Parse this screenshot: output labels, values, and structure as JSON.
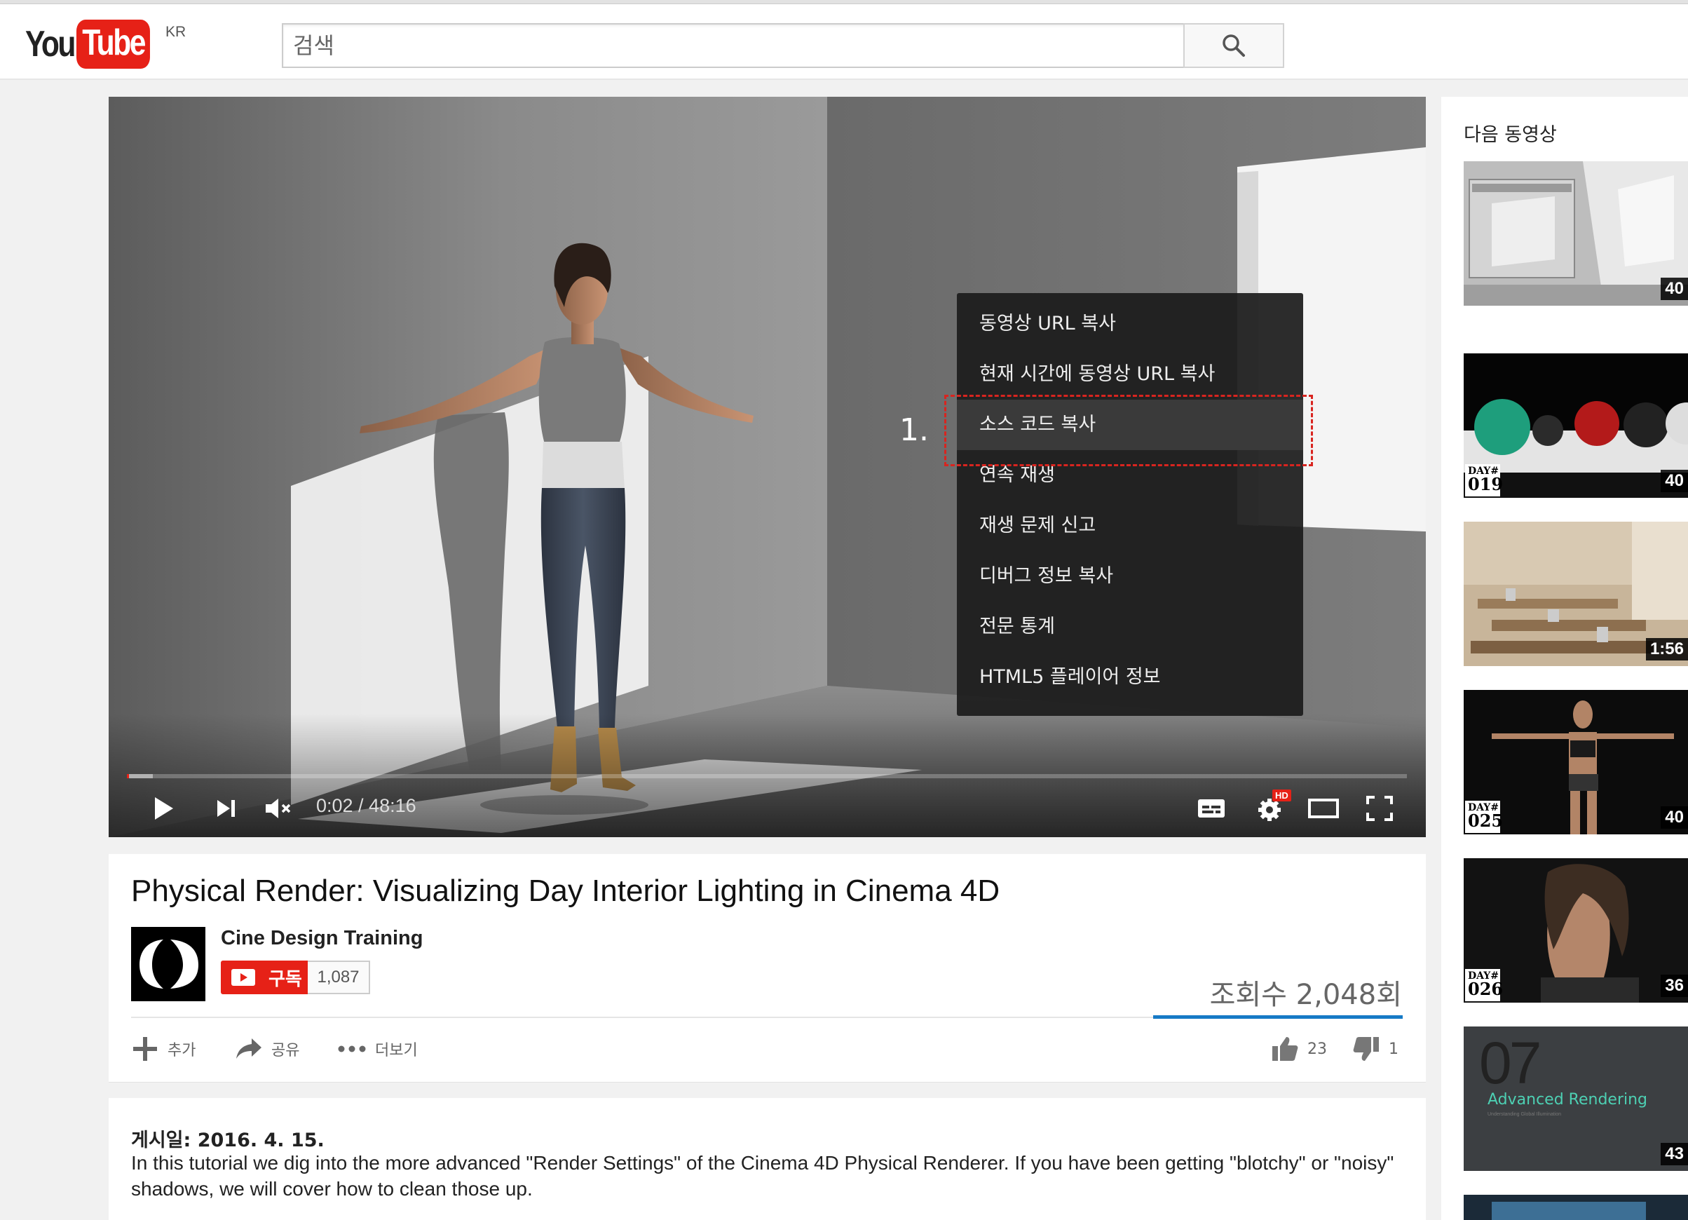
{
  "header": {
    "logo_you": "You",
    "logo_tube": "Tube",
    "region": "KR",
    "search_placeholder": "검색"
  },
  "player": {
    "time_display": "0:02 / 48:16",
    "progress_fraction": 0.001,
    "context_menu": {
      "items": [
        "동영상 URL 복사",
        "현재 시간에 동영상 URL 복사",
        "소스 코드 복사",
        "연속 재생",
        "재생 문제 신고",
        "디버그 정보 복사",
        "전문 통계",
        "HTML5 플레이어 정보"
      ],
      "highlighted_index": 2
    },
    "annotation_label": "1.",
    "hd_badge": "HD"
  },
  "video": {
    "title": "Physical Render: Visualizing Day Interior Lighting in Cinema 4D",
    "channel": "Cine Design Training",
    "subscribe_label": "구독",
    "subscriber_count": "1,087",
    "views": "조회수 2,048회",
    "actions": {
      "add": "추가",
      "share": "공유",
      "more": "더보기"
    },
    "likes": "23",
    "dislikes": "1"
  },
  "description": {
    "published": "게시일: 2016. 4. 15.",
    "text": "In this tutorial we dig into the more advanced \"Render Settings\" of the Cinema 4D Physical Renderer. If you have been getting \"blotchy\" or \"noisy\" shadows, we will cover how to clean those up."
  },
  "sidebar": {
    "heading": "다음 동영상",
    "recommendations": [
      {
        "duration": "40",
        "day_label": "",
        "day_num": ""
      },
      {
        "duration": "40",
        "day_label": "DAY#",
        "day_num": "019"
      },
      {
        "duration": "1:56",
        "day_label": "",
        "day_num": ""
      },
      {
        "duration": "40",
        "day_label": "DAY#",
        "day_num": "025"
      },
      {
        "duration": "36",
        "day_label": "DAY#",
        "day_num": "026"
      },
      {
        "duration": "43",
        "day_label": "",
        "day_num": "",
        "big_number": "07",
        "title": "Advanced Rendering",
        "subtitle": "Understanding Global Illumination"
      }
    ]
  },
  "colors": {
    "brand_red": "#e62117",
    "like_blue": "#167ac6",
    "annotation_red": "#d9241f",
    "accent_teal": "#4dd0b3"
  }
}
